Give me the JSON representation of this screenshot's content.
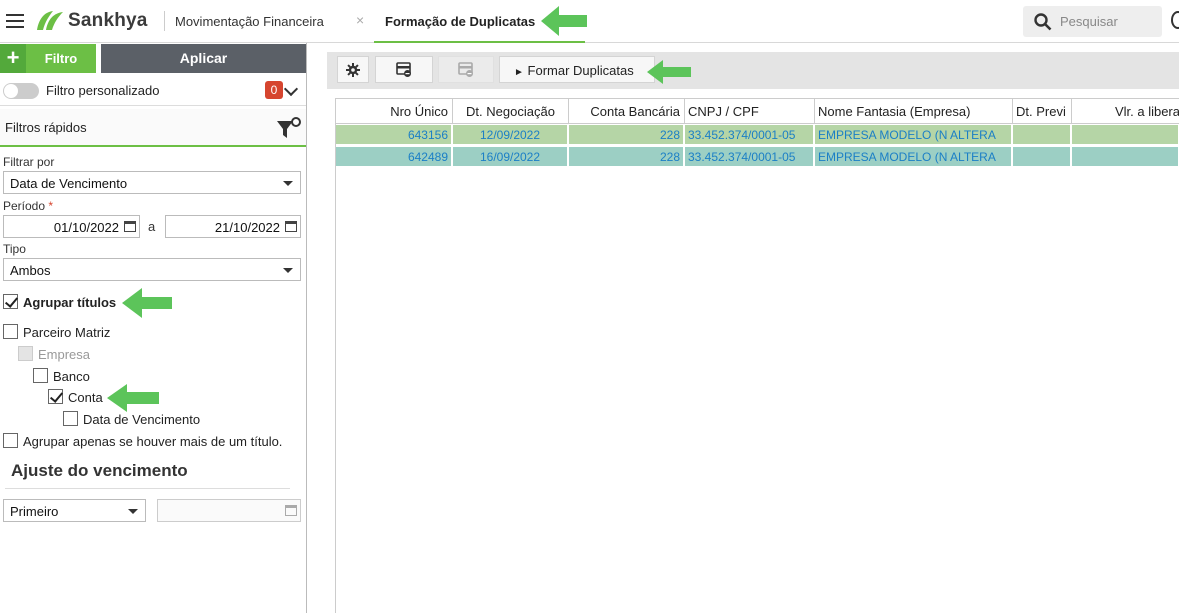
{
  "topbar": {
    "brand": "Sankhya",
    "tab1": "Movimentação Financeira",
    "tab1_close": "×",
    "tab2": "Formação de Duplicatas",
    "search_placeholder": "Pesquisar"
  },
  "filter_panel": {
    "add_symbol": "+",
    "filter_button": "Filtro",
    "apply_button": "Aplicar",
    "custom_filter_label": "Filtro personalizado",
    "custom_filter_count": "0",
    "quick_filters_label": "Filtros rápidos",
    "filter_by_label": "Filtrar por",
    "filter_by_value": "Data de Vencimento",
    "period_label": "Período",
    "required_mark": "*",
    "date_from": "01/10/2022",
    "date_sep": "a",
    "date_to": "21/10/2022",
    "type_label": "Tipo",
    "type_value": "Ambos",
    "group_titles": {
      "label": "Agrupar títulos",
      "checked": true
    },
    "partner_matrix": {
      "label": "Parceiro Matriz",
      "checked": false
    },
    "company": {
      "label": "Empresa",
      "checked": false,
      "disabled": true
    },
    "bank": {
      "label": "Banco",
      "checked": false
    },
    "account": {
      "label": "Conta",
      "checked": true
    },
    "due_date": {
      "label": "Data de Vencimento",
      "checked": false
    },
    "group_only_if": {
      "label": "Agrupar apenas se houver mais de um título.",
      "checked": false
    },
    "adjust_title": "Ajuste do vencimento",
    "adjust_value": "Primeiro",
    "adjust_date": ""
  },
  "toolbar": {
    "form_button": "Formar Duplicatas",
    "play_symbol": "►"
  },
  "grid": {
    "columns": [
      "Nro Único",
      "Dt. Negociação",
      "Conta Bancária",
      "CNPJ / CPF",
      "Nome Fantasia (Empresa)",
      "Dt. Previ",
      "Vlr. a libera"
    ],
    "rows": [
      {
        "nro": "643156",
        "dt": "12/09/2022",
        "conta": "228",
        "cnpj": "33.452.374/0001-05",
        "nome": "EMPRESA MODELO (N ALTERA",
        "prev": "",
        "vlr": "",
        "color": "#b5d5a6"
      },
      {
        "nro": "642489",
        "dt": "16/09/2022",
        "conta": "228",
        "cnpj": "33.452.374/0001-05",
        "nome": "EMPRESA MODELO (N ALTERA",
        "prev": "",
        "vlr": "",
        "color": "#9ccfc4"
      }
    ]
  },
  "colors": {
    "accent_green": "#6cbf45",
    "annotation_arrow": "#5cc45a",
    "badge_red": "#d6452f",
    "link_blue": "#1b7fc6"
  }
}
